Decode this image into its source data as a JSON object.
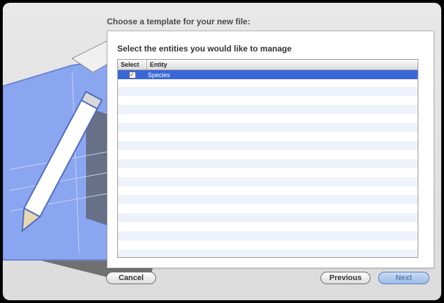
{
  "dialog": {
    "heading": "Choose a template for your new file:",
    "instruction": "Select the entities you would like to manage"
  },
  "table": {
    "headers": {
      "select": "Select",
      "entity": "Entity"
    },
    "rows": [
      {
        "entity": "Species",
        "checked": true,
        "selected": true
      }
    ],
    "checkmark": "✓"
  },
  "buttons": {
    "cancel": "Cancel",
    "previous": "Previous",
    "next": "Next"
  },
  "colors": {
    "selection": "#3a67d8",
    "stripe": "#eef2fa",
    "art_blue": "#8ba6f0"
  },
  "icons": {
    "artwork": "blueprint-pencil-icon"
  }
}
